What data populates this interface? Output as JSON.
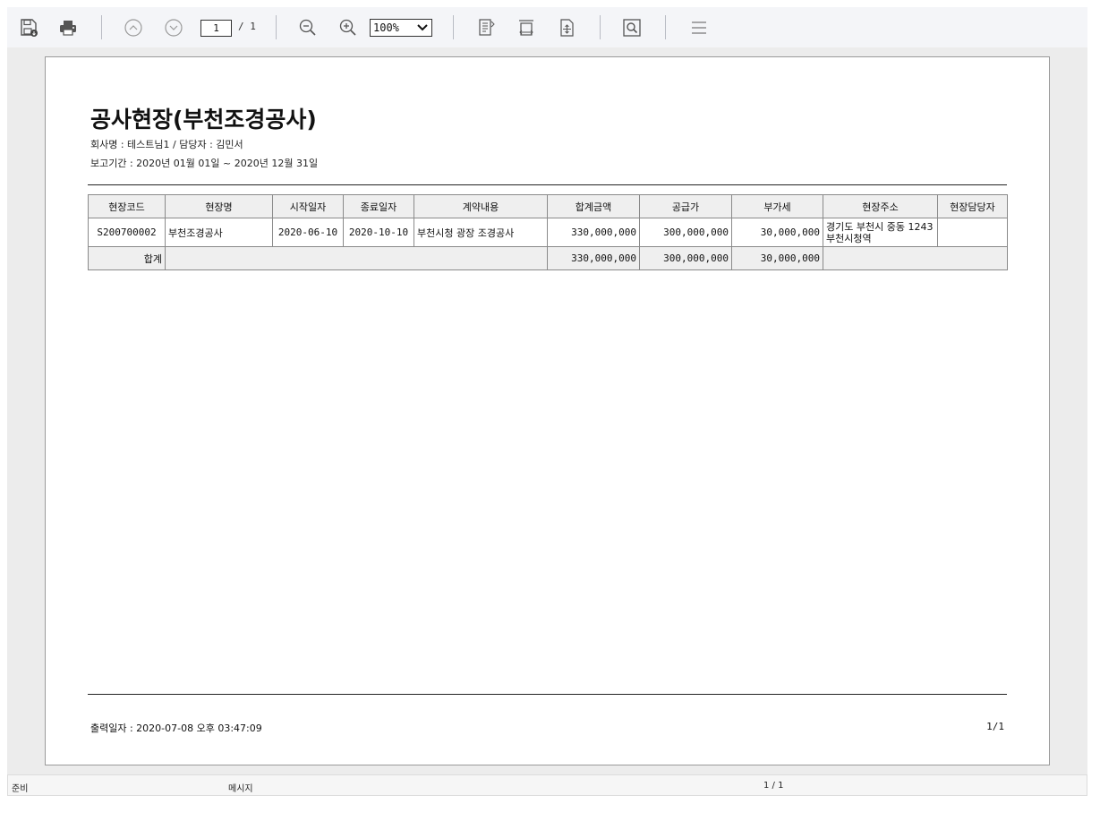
{
  "toolbar": {
    "page_current": "1",
    "page_total": "/ 1",
    "zoom": "100%"
  },
  "report": {
    "title": "공사현장(부천조경공사)",
    "company_line": "회사명 : 테스트님1 / 담당자 : 김민서",
    "period_line": "보고기간 : 2020년 01월 01일  ~ 2020년 12월 31일",
    "columns": [
      "현장코드",
      "현장명",
      "시작일자",
      "종료일자",
      "계약내용",
      "합계금액",
      "공급가",
      "부가세",
      "현장주소",
      "현장담당자"
    ],
    "rows": [
      {
        "code": "S200700002",
        "name": "부천조경공사",
        "start": "2020-06-10",
        "end": "2020-10-10",
        "contract": "부천시청 광장 조경공사",
        "total": "330,000,000",
        "supply": "300,000,000",
        "vat": "30,000,000",
        "address": "경기도 부천시 중동 1243 부천시청역",
        "manager": ""
      }
    ],
    "totals": {
      "label": "합계",
      "total": "330,000,000",
      "supply": "300,000,000",
      "vat": "30,000,000"
    },
    "footer_printed": "출력일자 : 2020-07-08   오후  03:47:09",
    "footer_page": "1/1"
  },
  "status": {
    "ready": "준비",
    "message": "메시지",
    "page": "1 / 1"
  }
}
